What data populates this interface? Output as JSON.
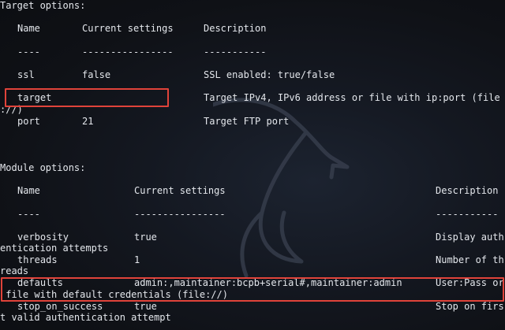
{
  "target_options": {
    "heading": "Target options:",
    "headers": {
      "name": "Name",
      "current": "Current settings",
      "description": "Description"
    },
    "dashes": {
      "name": "----",
      "current": "----------------",
      "description": "-----------"
    },
    "rows": [
      {
        "name": "ssl",
        "current": "false",
        "description": "SSL enabled: true/false"
      },
      {
        "name": "target",
        "current": "",
        "description": "Target IPv4, IPv6 address or file with ip:port (file",
        "wrap": "://)"
      },
      {
        "name": "port",
        "current": "21",
        "description": "Target FTP port"
      }
    ]
  },
  "module_options": {
    "heading": "Module options:",
    "headers": {
      "name": "Name",
      "current": "Current settings",
      "description": "Description"
    },
    "dashes": {
      "name": "----",
      "current": "----------------",
      "description": "-----------"
    },
    "rows": [
      {
        "name": "verbosity",
        "current": "true",
        "description": "Display auth",
        "wrap": "entication attempts"
      },
      {
        "name": "threads",
        "current": "1",
        "description": "Number of th",
        "wrap": "reads"
      },
      {
        "name": "defaults",
        "current": "admin:,maintainer:bcpb+serial#,maintainer:admin",
        "description": "User:Pass or",
        "wrap": " file with default credentials (file://)"
      },
      {
        "name": "stop_on_success",
        "current": "true",
        "description": "Stop on firs",
        "wrap": "t valid authentication attempt"
      }
    ]
  },
  "colors": {
    "background": "#0f1116",
    "text": "#e4e7ec",
    "highlight": "#e0433a",
    "logo": "#3a4150"
  },
  "icons": {
    "background_logo": "kali-dragon-icon"
  }
}
